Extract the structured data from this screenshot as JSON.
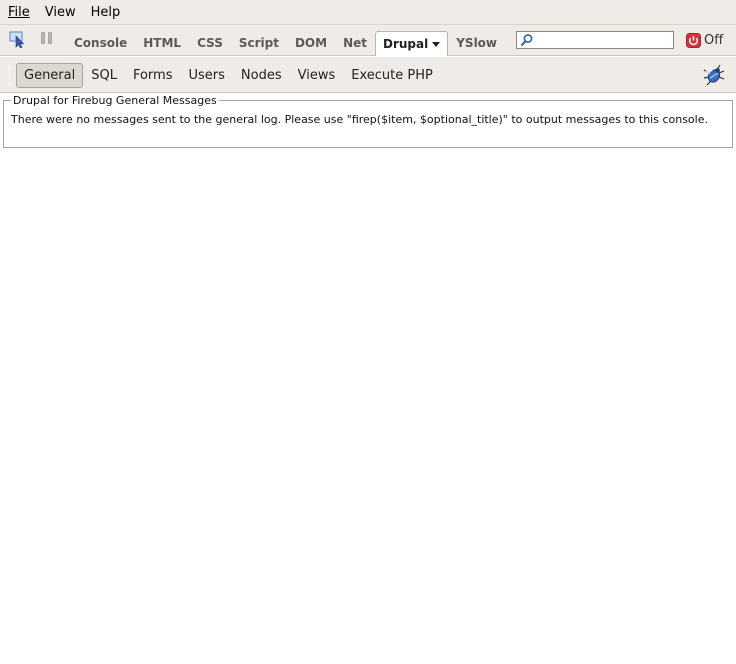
{
  "menubar": {
    "file": "File",
    "view": "View",
    "help": "Help"
  },
  "toolbar": {
    "inspect_icon": "inspect-cursor-icon",
    "pause_icon": "pause-icon",
    "tabs": [
      {
        "label": "Console"
      },
      {
        "label": "HTML"
      },
      {
        "label": "CSS"
      },
      {
        "label": "Script"
      },
      {
        "label": "DOM"
      },
      {
        "label": "Net"
      },
      {
        "label": "Drupal",
        "selected": true
      },
      {
        "label": "YSlow"
      }
    ],
    "search_value": "",
    "off_label": "Off"
  },
  "subtoolbar": {
    "tabs": [
      {
        "label": "General",
        "selected": true
      },
      {
        "label": "SQL"
      },
      {
        "label": "Forms"
      },
      {
        "label": "Users"
      },
      {
        "label": "Nodes"
      },
      {
        "label": "Views"
      },
      {
        "label": "Execute PHP"
      }
    ],
    "bug_icon": "firebug-icon"
  },
  "panel": {
    "legend": "Drupal for Firebug General Messages",
    "message": "There were no messages sent to the general log. Please use \"firep($item, $optional_title)\" to output messages to this console."
  },
  "colors": {
    "chrome_bg": "#efebe7",
    "power_red": "#d9333a"
  }
}
